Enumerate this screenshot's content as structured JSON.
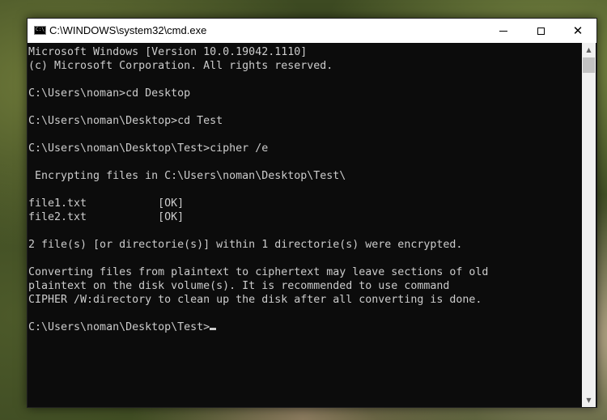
{
  "window": {
    "title": "C:\\WINDOWS\\system32\\cmd.exe",
    "icon_label": "C:\\_",
    "minimize_icon": "minimize-icon",
    "maximize_icon": "maximize-icon",
    "close_label": "✕"
  },
  "console": {
    "lines": [
      "Microsoft Windows [Version 10.0.19042.1110]",
      "(c) Microsoft Corporation. All rights reserved.",
      "",
      "C:\\Users\\noman>cd Desktop",
      "",
      "C:\\Users\\noman\\Desktop>cd Test",
      "",
      "C:\\Users\\noman\\Desktop\\Test>cipher /e",
      "",
      " Encrypting files in C:\\Users\\noman\\Desktop\\Test\\",
      "",
      "file1.txt           [OK]",
      "file2.txt           [OK]",
      "",
      "2 file(s) [or directorie(s)] within 1 directorie(s) were encrypted.",
      "",
      "Converting files from plaintext to ciphertext may leave sections of old",
      "plaintext on the disk volume(s). It is recommended to use command",
      "CIPHER /W:directory to clean up the disk after all converting is done.",
      ""
    ],
    "prompt": "C:\\Users\\noman\\Desktop\\Test>"
  },
  "scrollbar": {
    "up_arrow": "▲",
    "down_arrow": "▼"
  },
  "colors": {
    "console_bg": "#0c0c0c",
    "console_text": "#cccccc",
    "titlebar_bg": "#ffffff"
  }
}
